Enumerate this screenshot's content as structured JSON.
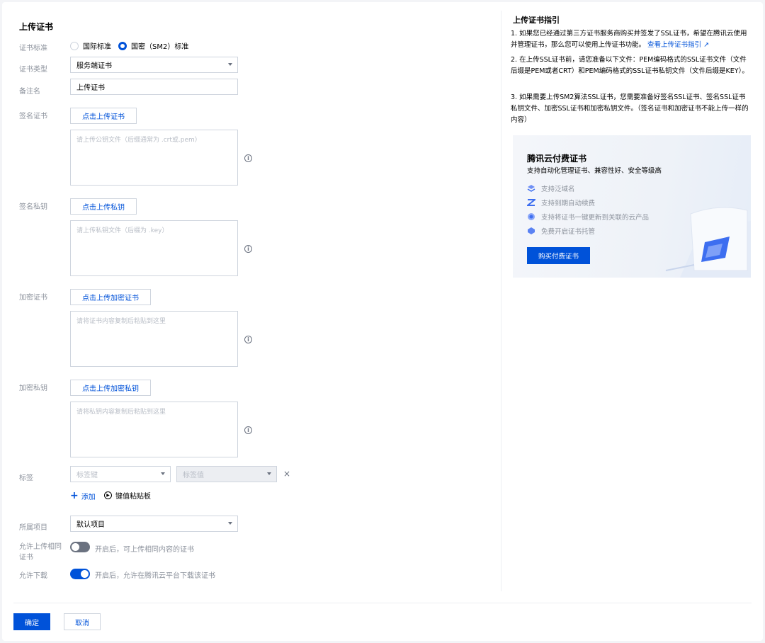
{
  "page": {
    "title": "上传证书"
  },
  "form": {
    "cert_standard": {
      "label": "证书标准",
      "options": [
        "国际标准",
        "国密（SM2）标准"
      ],
      "selected": "国密（SM2）标准"
    },
    "cert_type": {
      "label": "证书类型",
      "value": "服务端证书"
    },
    "remark": {
      "label": "备注名",
      "value": "上传证书"
    },
    "sign_cert": {
      "label": "签名证书",
      "button": "点击上传证书",
      "placeholder": "请上传公钥文件（后缀通常为 .crt或.pem）"
    },
    "sign_key": {
      "label": "签名私钥",
      "button": "点击上传私钥",
      "placeholder": "请上传私钥文件（后缀为 .key）"
    },
    "enc_cert": {
      "label": "加密证书",
      "button": "点击上传加密证书",
      "placeholder": "请将证书内容复制后粘贴到这里"
    },
    "enc_key": {
      "label": "加密私钥",
      "button": "点击上传加密私钥",
      "placeholder": "请将私钥内容复制后粘贴到这里"
    },
    "tags": {
      "label": "标签",
      "key_placeholder": "标签键",
      "value_placeholder": "标签值",
      "add": "添加",
      "paste": "键值粘贴板"
    },
    "project": {
      "label": "所属项目",
      "value": "默认项目"
    },
    "allow_same": {
      "label_line1": "允许上传相同",
      "label_line2": "证书",
      "enabled": false,
      "desc": "开启后，可上传相同内容的证书"
    },
    "allow_download": {
      "label": "允许下载",
      "enabled": true,
      "desc": "开启后，允许在腾讯云平台下载该证书"
    }
  },
  "footer": {
    "confirm": "确定",
    "cancel": "取消"
  },
  "guide": {
    "title": "上传证书指引",
    "item1": "1. 如果您已经通过第三方证书服务商购买并签发了SSL证书，希望在腾讯云使用并管理证书，那么您可以使用上传证书功能。",
    "item1_link": "查看上传证书指引",
    "item2": "2. 在上传SSL证书前，请您准备以下文件：PEM编码格式的SSL证书文件（文件后缀是PEM或者CRT）和PEM编码格式的SSL证书私钥文件（文件后缀是KEY）。",
    "item3": "3. 如果需要上传SM2算法SSL证书，您需要准备好签名SSL证书、签名SSL证书私钥文件、加密SSL证书和加密私钥文件。（签名证书和加密证书不能上传一样的内容）"
  },
  "promo": {
    "title": "腾讯云付费证书",
    "subtitle": "支持自动化管理证书、兼容性好、安全等级高",
    "features": [
      "支持泛域名",
      "支持到期自动续费",
      "支持将证书一键更新到关联的云产品",
      "免费开启证书托管"
    ],
    "button": "购买付费证书"
  },
  "colors": {
    "primary": "#0052d9",
    "border": "#cfd5de",
    "muted": "#8c929c"
  }
}
